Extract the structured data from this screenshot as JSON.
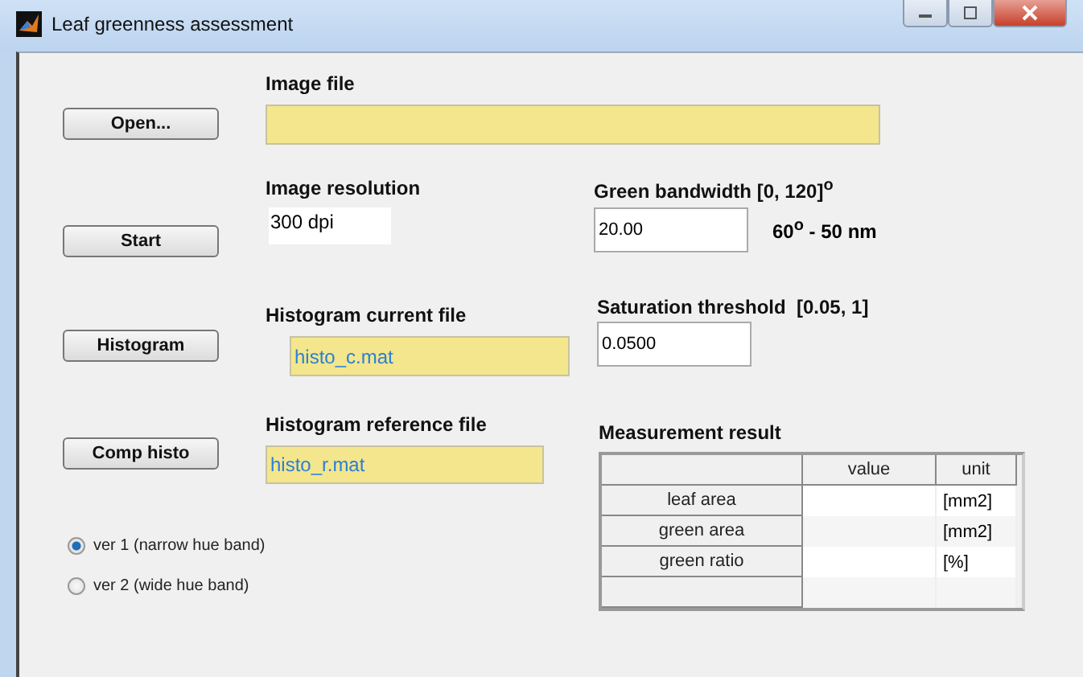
{
  "window": {
    "title": "Leaf greenness assessment"
  },
  "buttons": [
    "Open...",
    "Start",
    "Histogram",
    "Comp histo"
  ],
  "image_file": {
    "label": "Image file"
  },
  "image_resolution": {
    "label": "Image resolution",
    "value": "300 dpi"
  },
  "green_bandwidth": {
    "label": "Green bandwidth [0, 120]$^{o}$",
    "value": "20.00",
    "note": "60$^{o}$ - 50 nm"
  },
  "histogram_current": {
    "label": "Histogram current file",
    "value": "histo_c.mat"
  },
  "saturation_threshold": {
    "label": "Saturation threshold  [0.05, 1]",
    "value": "0.0500"
  },
  "histogram_reference": {
    "label": "Histogram reference file",
    "value": "histo_r.mat"
  },
  "measurement": {
    "title": "Measurement result",
    "columns": [
      "value",
      "unit"
    ],
    "rows": [
      {
        "name": "leaf area",
        "unit": "[mm2]"
      },
      {
        "name": "green area",
        "unit": "[mm2]"
      },
      {
        "name": "green ratio",
        "unit": "[%]"
      }
    ]
  },
  "versions": [
    {
      "label": "ver 1 (narrow hue band)",
      "selected": true
    },
    {
      "label": "ver 2 (wide hue band)",
      "selected": false
    }
  ]
}
